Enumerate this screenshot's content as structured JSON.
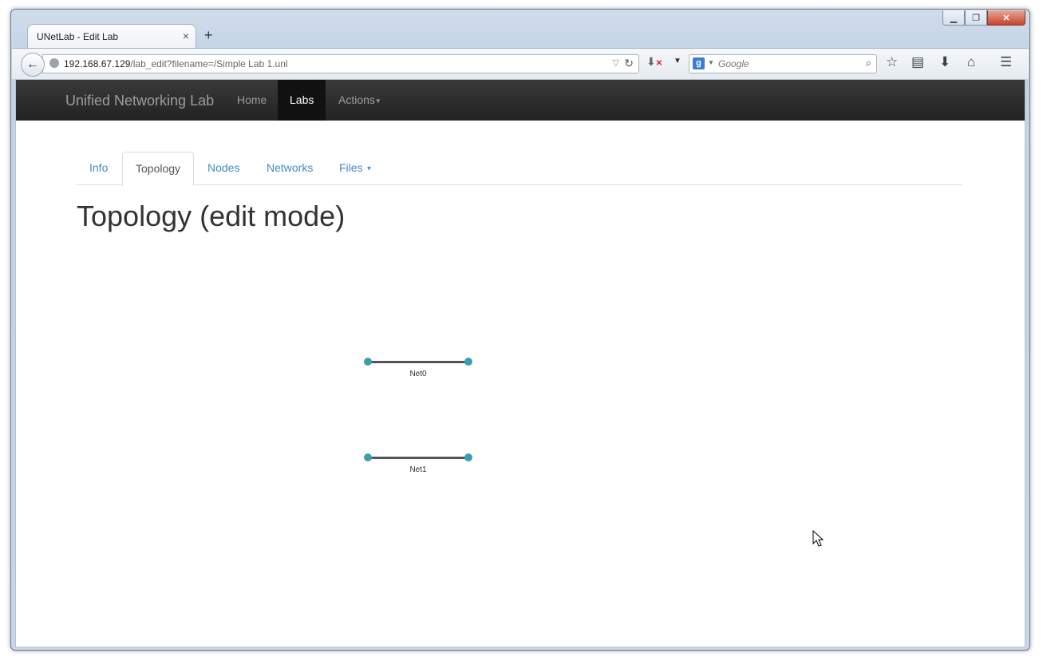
{
  "browser": {
    "tab_title": "UNetLab - Edit Lab",
    "tab_close": "×",
    "new_tab": "+",
    "url_host": "192.168.67.129",
    "url_path": "/lab_edit?filename=/Simple Lab 1.unl",
    "search_placeholder": "Google",
    "search_engine_letter": "g"
  },
  "app": {
    "brand": "Unified Networking Lab",
    "nav": [
      {
        "label": "Home"
      },
      {
        "label": "Labs"
      },
      {
        "label": "Actions"
      }
    ]
  },
  "tabs": [
    {
      "label": "Info"
    },
    {
      "label": "Topology"
    },
    {
      "label": "Nodes"
    },
    {
      "label": "Networks"
    },
    {
      "label": "Files"
    }
  ],
  "page_title": "Topology (edit mode)",
  "networks": [
    {
      "label": "Net0"
    },
    {
      "label": "Net1"
    }
  ]
}
